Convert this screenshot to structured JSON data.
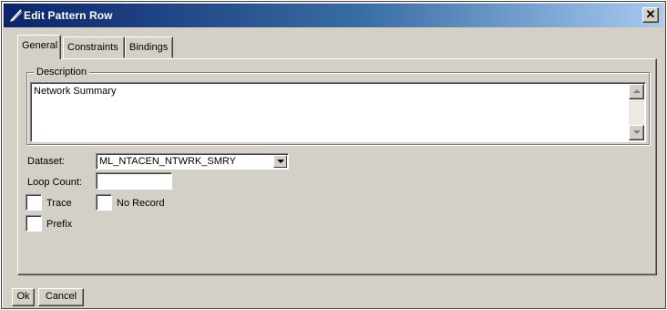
{
  "window": {
    "title": "Edit Pattern Row",
    "close_glyph": "✕"
  },
  "tabs": [
    {
      "label": "General",
      "active": true
    },
    {
      "label": "Constraints",
      "active": false
    },
    {
      "label": "Bindings",
      "active": false
    }
  ],
  "description": {
    "legend": "Description",
    "value": "Network Summary"
  },
  "fields": {
    "dataset_label": "Dataset:",
    "dataset_value": "ML_NTACEN_NTWRK_SMRY",
    "loop_count_label": "Loop Count:",
    "loop_count_value": ""
  },
  "checkboxes": {
    "trace_label": "Trace",
    "trace_checked": false,
    "no_record_label": "No Record",
    "no_record_checked": false,
    "prefix_label": "Prefix",
    "prefix_checked": false
  },
  "buttons": {
    "ok_label": "Ok",
    "cancel_label": "Cancel"
  },
  "colors": {
    "title_start": "#0a246a",
    "title_end": "#a6caf0",
    "face": "#d4d0c8"
  }
}
